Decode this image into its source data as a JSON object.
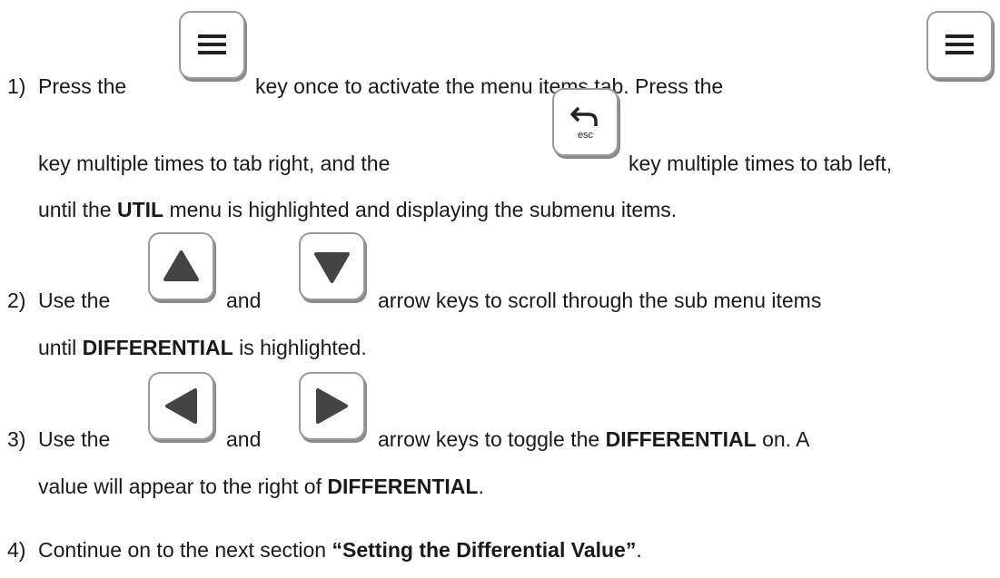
{
  "steps": [
    {
      "number": "1)",
      "line1_a": "Press the",
      "line1_b": "key once to activate the menu items tab.  Press the",
      "line2_a": "key multiple times to tab right, and the",
      "line2_b": "key multiple times to tab left,",
      "line3_a": "until the ",
      "line3_bold": "UTIL",
      "line3_b": " menu is highlighted and displaying the submenu items."
    },
    {
      "number": "2)",
      "line1_a": "Use the",
      "line1_and": "and",
      "line1_b": "arrow keys to scroll through the sub menu items",
      "line2_a": "until ",
      "line2_bold": "DIFFERENTIAL",
      "line2_b": " is highlighted."
    },
    {
      "number": "3)",
      "line1_a": "Use the",
      "line1_and": "and",
      "line1_b": "arrow keys to toggle the ",
      "line1_bold": "DIFFERENTIAL",
      "line1_c": " on.  A",
      "line2_a": "value will appear to the right of ",
      "line2_bold": "DIFFERENTIAL",
      "line2_b": "."
    },
    {
      "number": "4)",
      "line1_a": "Continue on to the next section ",
      "line1_bold": "“Setting the Differential Value”",
      "line1_b": "."
    }
  ],
  "keys": {
    "menu_icon": "menu-lines-icon",
    "esc_icon": "back-arrow-icon",
    "esc_label": "esc",
    "up_icon": "up-triangle-icon",
    "down_icon": "down-triangle-icon",
    "left_icon": "left-triangle-icon",
    "right_icon": "right-triangle-icon"
  }
}
